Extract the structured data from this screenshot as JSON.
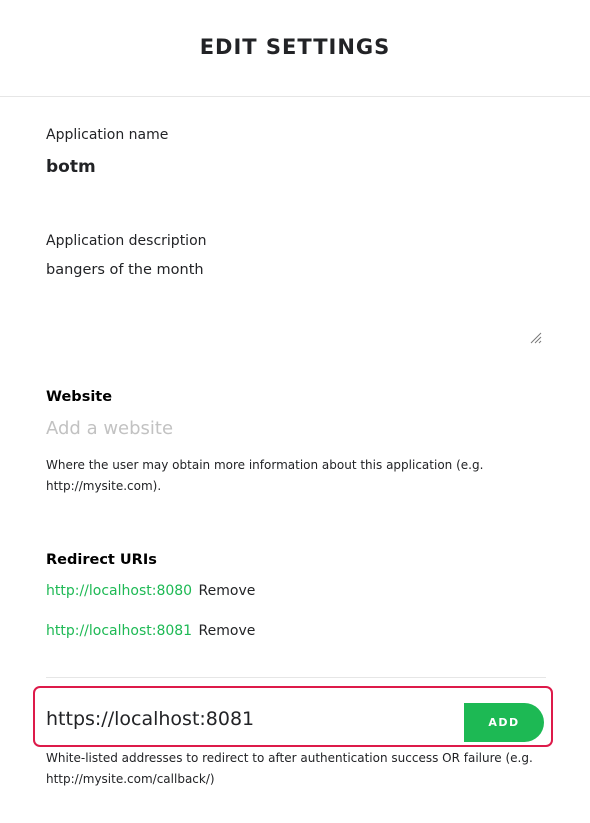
{
  "header": {
    "title": "EDIT SETTINGS"
  },
  "app_name": {
    "label": "Application name",
    "value": "botm"
  },
  "app_description": {
    "label": "Application description",
    "value": "bangers of the month"
  },
  "website": {
    "label": "Website",
    "placeholder": "Add a website",
    "help_line1": "Where the user may obtain more information about this application (e.g.",
    "help_line2": "http://mysite.com)."
  },
  "redirect_uris": {
    "label": "Redirect URIs",
    "items": [
      {
        "uri": "http://localhost:8080",
        "remove_label": "Remove"
      },
      {
        "uri": "http://localhost:8081",
        "remove_label": "Remove"
      }
    ],
    "new_uri_value": "https://localhost:8081",
    "add_label": "ADD",
    "help_line1": "White-listed addresses to redirect to after authentication success OR failure (e.g.",
    "help_line2": "http://mysite.com/callback/)"
  },
  "colors": {
    "accent_green": "#1db954",
    "highlight_red": "#dd1a4a",
    "placeholder_gray": "#c2c2c2"
  },
  "icons": {
    "resize": "resize-handle-icon"
  }
}
